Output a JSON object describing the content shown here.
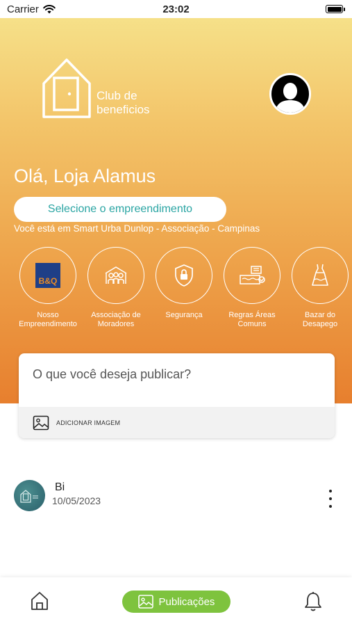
{
  "status_bar": {
    "carrier": "Carrier",
    "time": "23:02"
  },
  "header": {
    "logo_line1": "Club de",
    "logo_line2": "beneficios",
    "greeting": "Olá, Loja Alamus",
    "select_button": "Selecione o empreendimento",
    "location": "Você está em Smart Urba Dunlop - Associação - Campinas"
  },
  "categories": [
    {
      "label_line1": "Nosso",
      "label_line2": "Empreendimento",
      "icon": "bq-logo",
      "logo_text": "B&Q"
    },
    {
      "label_line1": "Associação de",
      "label_line2": "Moradores",
      "icon": "people-house-icon"
    },
    {
      "label_line1": "Segurança",
      "label_line2": "",
      "icon": "shield-lock-icon"
    },
    {
      "label_line1": "Regras Áreas",
      "label_line2": "Comuns",
      "icon": "pool-icon"
    },
    {
      "label_line1": "Bazar do",
      "label_line2": "Desapego",
      "icon": "dress-icon"
    }
  ],
  "composer": {
    "placeholder": "O que você deseja publicar?",
    "add_image_label": "ADICIONAR IMAGEM"
  },
  "post": {
    "author": "Bi",
    "date": "10/05/2023"
  },
  "tabbar": {
    "home_icon": "home-icon",
    "publications_label": "Publicações",
    "bell_icon": "bell-icon"
  },
  "colors": {
    "accent_green": "#7ec33e",
    "teal_text": "#2aa5a3",
    "gradient_top": "#f6e58e",
    "gradient_bottom": "#e77f2e"
  }
}
